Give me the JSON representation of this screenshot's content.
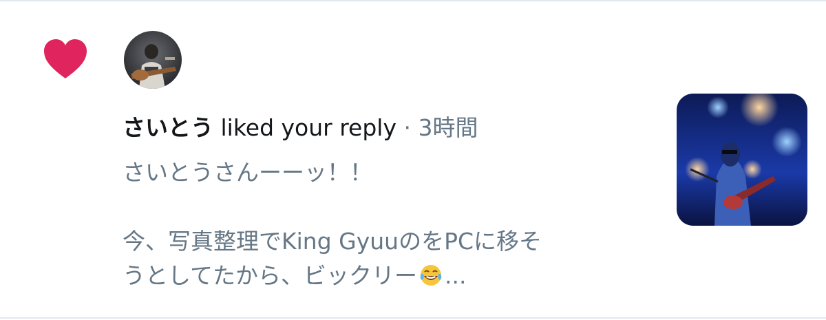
{
  "notification": {
    "user_name": "さいとう",
    "action_text": "liked your reply",
    "separator": "·",
    "timestamp": "3時間",
    "body_line_1": "さいとうさんーーッ！！",
    "body_line_3": "今、写真整理でKing GyuuのをPCに移そ",
    "body_line_4_prefix": "うとしてたから、ビックリー",
    "body_line_4_suffix": "...",
    "emoji": "face-with-tears-of-joy",
    "icons": {
      "like": "heart-icon"
    },
    "colors": {
      "heart": "#e0245e",
      "primary_text": "#14171a",
      "secondary_text": "#657786",
      "divider": "#e1e8ed"
    }
  }
}
